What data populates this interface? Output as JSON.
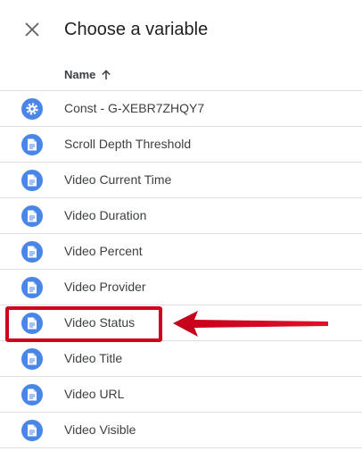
{
  "dialog": {
    "title": "Choose a variable",
    "close_icon": "close-icon"
  },
  "table": {
    "column_header": "Name",
    "sort_icon": "arrow-up-icon",
    "rows": [
      {
        "label": "Const - G-XEBR7ZHQY7",
        "icon": "gear-icon"
      },
      {
        "label": "Scroll Depth Threshold",
        "icon": "document-icon"
      },
      {
        "label": "Video Current Time",
        "icon": "document-icon"
      },
      {
        "label": "Video Duration",
        "icon": "document-icon"
      },
      {
        "label": "Video Percent",
        "icon": "document-icon"
      },
      {
        "label": "Video Provider",
        "icon": "document-icon"
      },
      {
        "label": "Video Status",
        "icon": "document-icon"
      },
      {
        "label": "Video Title",
        "icon": "document-icon"
      },
      {
        "label": "Video URL",
        "icon": "document-icon"
      },
      {
        "label": "Video Visible",
        "icon": "document-icon"
      }
    ]
  },
  "annotation": {
    "highlighted_row": "Video Status",
    "color": "#d0021b"
  },
  "colors": {
    "icon_badge": "#4a86e8",
    "divider": "#e0e0e0"
  }
}
